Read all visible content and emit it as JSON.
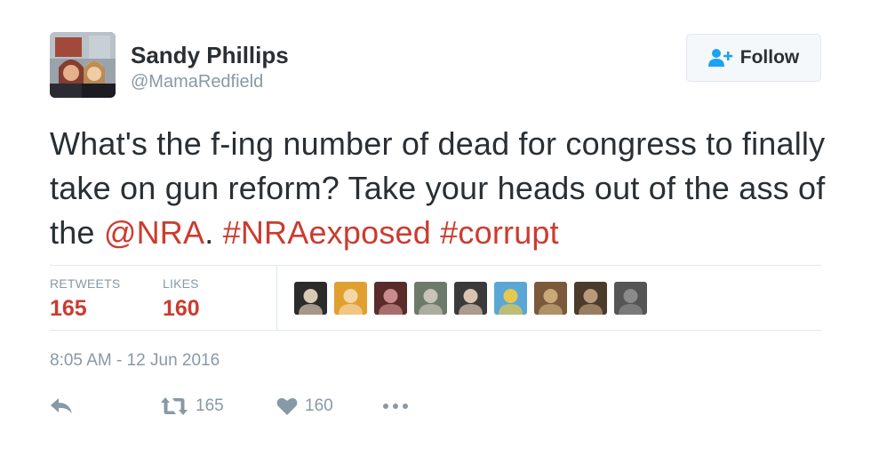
{
  "user": {
    "name": "Sandy Phillips",
    "handle": "@MamaRedfield"
  },
  "follow_button": {
    "label": "Follow",
    "icon": "add-user-icon"
  },
  "tweet": {
    "text_part1": "What's the f-ing number of dead for congress to finally take on gun reform? Take your heads out of the ass of the ",
    "mention": "@NRA",
    "text_part2": ". ",
    "hashtag1": "#NRAexposed",
    "text_part3": " ",
    "hashtag2": "#corrupt",
    "link_color": "#cc3b2f"
  },
  "stats": {
    "retweets_label": "RETWEETS",
    "retweets_value": "165",
    "likes_label": "LIKES",
    "likes_value": "160"
  },
  "likers": [
    {
      "colors": [
        "#2b2b2b",
        "#d9c9b0"
      ]
    },
    {
      "colors": [
        "#e0a030",
        "#f4d7a8"
      ]
    },
    {
      "colors": [
        "#5a2b2b",
        "#c98b8b"
      ]
    },
    {
      "colors": [
        "#6c7a6a",
        "#c8c2b8"
      ]
    },
    {
      "colors": [
        "#3a3a3a",
        "#d8c4b0"
      ]
    },
    {
      "colors": [
        "#5aa7d6",
        "#e6c84f"
      ]
    },
    {
      "colors": [
        "#7a5a3a",
        "#c9a97a"
      ]
    },
    {
      "colors": [
        "#4a3b2a",
        "#b99a7a"
      ]
    },
    {
      "colors": [
        "#555555",
        "#8a8a8a"
      ]
    }
  ],
  "timestamp": "8:05 AM - 12 Jun 2016",
  "actions": {
    "retweet_count": "165",
    "like_count": "160"
  },
  "colors": {
    "text": "#292f33",
    "muted": "#8899a6",
    "accent": "#cc3b2f",
    "follow_icon": "#1da1f2"
  }
}
